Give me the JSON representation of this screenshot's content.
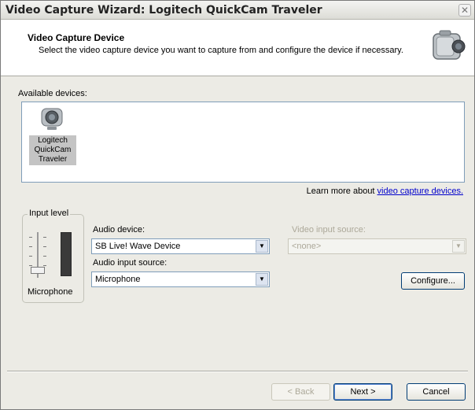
{
  "window": {
    "title": "Video Capture Wizard: Logitech QuickCam Traveler"
  },
  "header": {
    "title": "Video Capture Device",
    "description": "Select the video capture device you want to capture from and configure the device if necessary."
  },
  "devices": {
    "label": "Available devices:",
    "items": [
      {
        "label": "Logitech QuickCam Traveler",
        "selected": true
      }
    ]
  },
  "learn_more": {
    "prefix": "Learn more about ",
    "link": "video capture devices."
  },
  "input_level": {
    "group_label": "Input level",
    "caption": "Microphone",
    "meter_level": 1.0
  },
  "audio_device": {
    "label": "Audio device:",
    "value": "SB Live! Wave Device"
  },
  "audio_input_source": {
    "label": "Audio input source:",
    "value": "Microphone"
  },
  "video_input_source": {
    "label": "Video input source:",
    "value": "<none>",
    "enabled": false
  },
  "buttons": {
    "configure": "Configure...",
    "back": "< Back",
    "next": "Next >",
    "cancel": "Cancel"
  },
  "colors": {
    "link": "#0000cc",
    "disabled_text": "#aca899",
    "input_border": "#7f9db9"
  },
  "icons": {
    "header": "video-camera-icon",
    "device": "webcam-icon",
    "close": "close-icon",
    "dropdown": "chevron-down-icon"
  }
}
